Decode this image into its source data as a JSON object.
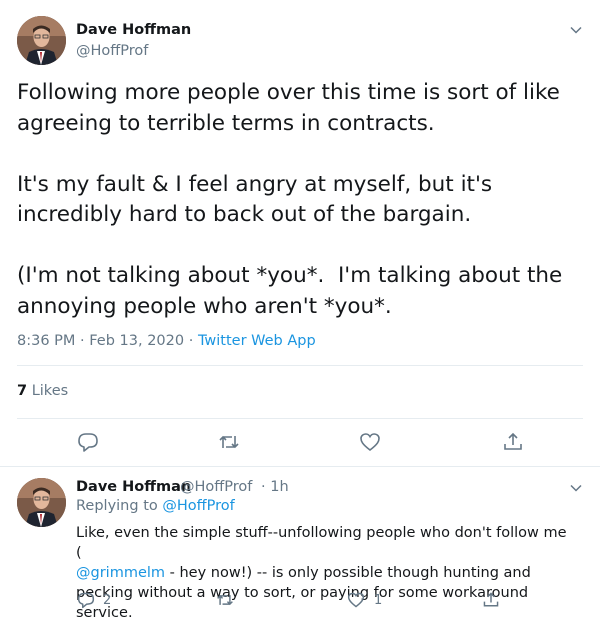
{
  "main_tweet": {
    "author_name": "Dave Hoffman",
    "author_handle": "@HoffProf",
    "text_p1": "Following more people over this time is sort of like agreeing to terrible terms in contracts.",
    "text_p2": "It's my fault & I feel angry at myself, but it's incredibly hard to back out of the bargain.",
    "text_p3": "(I'm not talking about *you*.  I'm talking about the annoying people who aren't *you*.",
    "timestamp": "8:36 PM · Feb 13, 2020 ·",
    "source": "Twitter Web App",
    "likes_count": "7",
    "likes_label": "Likes"
  },
  "reply_tweet": {
    "author_name": "Dave Hoffman",
    "author_handle": "@HoffProf",
    "time": "· 1h",
    "replying_label": "Replying to",
    "replying_to": "@HoffProf",
    "text_start": "Like, even the simple stuff--unfollowing people who don't follow me (",
    "mention": "@grimmelm",
    "text_end": " -  hey now!) -- is only possible though hunting and pecking without a way to sort, or paying for some workaround service.",
    "reply_count": "2",
    "like_count": "1"
  },
  "colors": {
    "text": "#14171a",
    "secondary": "#657786",
    "link": "#1b95e0",
    "divider": "#e6ecf0"
  }
}
